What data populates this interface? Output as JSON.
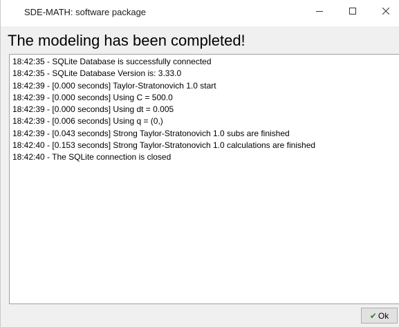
{
  "window": {
    "title": "SDE-MATH: software package"
  },
  "heading": "The modeling has been completed!",
  "log_lines": [
    "18:42:35 - SQLite Database is successfully connected",
    "18:42:35 - SQLite Database Version is: 3.33.0",
    "18:42:39 - [0.000 seconds] Taylor-Stratonovich 1.0 start",
    "18:42:39 - [0.000 seconds] Using C = 500.0",
    "18:42:39 - [0.000 seconds] Using dt = 0.005",
    "18:42:39 - [0.006 seconds] Using q = (0,)",
    "18:42:39 - [0.043 seconds] Strong Taylor-Stratonovich 1.0 subs are finished",
    "18:42:40 - [0.153 seconds] Strong Taylor-Stratonovich 1.0 calculations are finished",
    "18:42:40 - The SQLite connection is closed"
  ],
  "ok_button": {
    "label": "Ok",
    "icon": "checkmark-icon",
    "icon_color": "#2e7d32"
  },
  "window_controls": {
    "minimize_icon": "minimize-icon",
    "maximize_icon": "maximize-icon",
    "close_icon": "close-icon"
  }
}
